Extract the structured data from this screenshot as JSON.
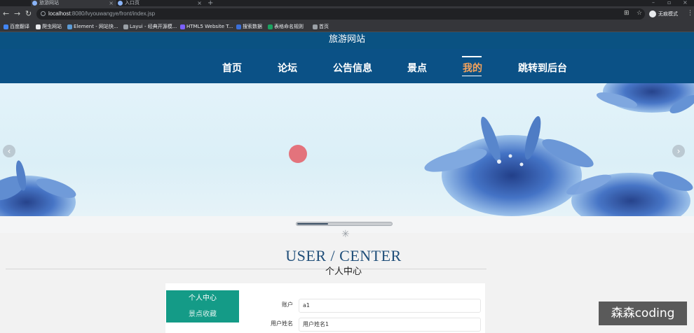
{
  "browser": {
    "tabs": [
      {
        "label": "旅游网站",
        "close": "×"
      },
      {
        "label": "入口页",
        "close": "×"
      }
    ],
    "new_tab": "+",
    "window_controls": {
      "minimize": "–",
      "maximize": "▫",
      "close": "×"
    },
    "url_host": "localhost",
    "url_rest": ":8080/lvyouwangye/front/index.jsp",
    "profile_label": "无痕模式",
    "bookmarks": [
      {
        "label": "百度翻译",
        "color": "#4285f4"
      },
      {
        "label": "爬虫网站",
        "color": "#e8eaed"
      },
      {
        "label": "Element - 网站快...",
        "color": "#5b9bd5"
      },
      {
        "label": "Layui - 经典开源模...",
        "color": "#9aa0a6"
      },
      {
        "label": "HTML5 Website T...",
        "color": "#7b61ff"
      },
      {
        "label": "搜索数据",
        "color": "#3b6fd8"
      },
      {
        "label": "表格命名规则",
        "color": "#1aa260"
      },
      {
        "label": "首页",
        "color": "#9aa0a6"
      }
    ]
  },
  "site": {
    "title": "旅游网站",
    "nav": [
      {
        "label": "首页",
        "active": false
      },
      {
        "label": "论坛",
        "active": false
      },
      {
        "label": "公告信息",
        "active": false
      },
      {
        "label": "景点",
        "active": false
      },
      {
        "label": "我的",
        "active": true
      },
      {
        "label": "跳转到后台",
        "active": false
      }
    ],
    "active_color": "#f6a35b"
  },
  "banner": {
    "prev_label": "‹",
    "next_label": "›",
    "progress": 0.33
  },
  "user_center": {
    "title": "USER / CENTER",
    "subtitle": "个人中心",
    "menu": [
      "个人中心",
      "景点收藏"
    ],
    "fields": [
      {
        "label": "账户",
        "value": "a1"
      },
      {
        "label": "用户姓名",
        "value": "用户姓名1"
      }
    ]
  },
  "watermark": "森森coding"
}
